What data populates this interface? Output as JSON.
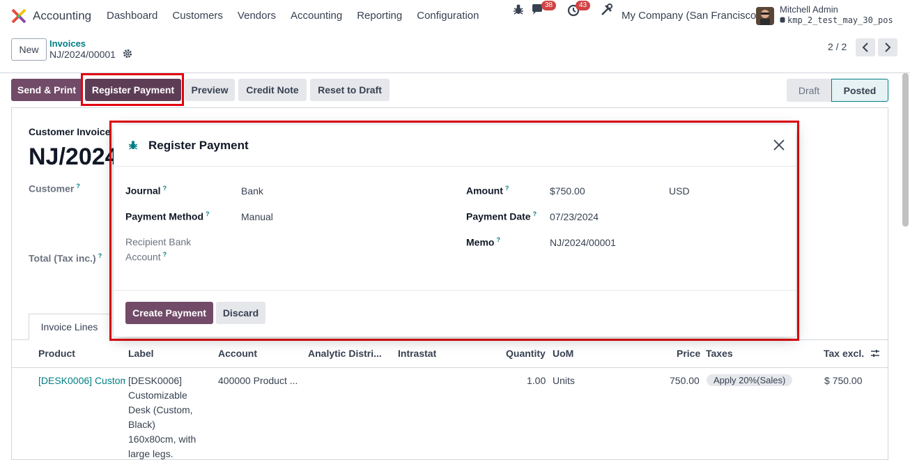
{
  "navbar": {
    "app_name": "Accounting",
    "menu": [
      "Dashboard",
      "Customers",
      "Vendors",
      "Accounting",
      "Reporting",
      "Configuration"
    ],
    "chat_badge": "38",
    "activity_badge": "43",
    "company": "My Company (San Francisco)",
    "user_name": "Mitchell Admin",
    "db_name": "kmp_2_test_may_30_pos"
  },
  "control": {
    "new_label": "New",
    "breadcrumb_parent": "Invoices",
    "breadcrumb_current": "NJ/2024/00001",
    "pager": "2 / 2"
  },
  "actions": {
    "send_print": "Send & Print",
    "register_payment": "Register Payment",
    "preview": "Preview",
    "credit_note": "Credit Note",
    "reset_draft": "Reset to Draft",
    "status_draft": "Draft",
    "status_posted": "Posted"
  },
  "sheet": {
    "type": "Customer Invoice",
    "name_partial": "NJ/2024",
    "customer_label": "Customer",
    "total_label": "Total (Tax inc.)",
    "tab_lines": "Invoice Lines",
    "columns": [
      "Product",
      "Label",
      "Account",
      "Analytic Distri...",
      "Intrastat",
      "Quantity",
      "UoM",
      "Price",
      "Taxes",
      "Tax excl."
    ],
    "row": {
      "product": "[DESK0006] Custom",
      "label_lines": [
        "[DESK0006]",
        "Customizable",
        "Desk (Custom,",
        "Black)",
        "160x80cm, with",
        "large legs."
      ],
      "account": "400000 Product ...",
      "quantity": "1.00",
      "uom": "Units",
      "price": "750.00",
      "tax": "Apply 20%(Sales)",
      "tax_excl": "$ 750.00"
    }
  },
  "modal": {
    "title": "Register Payment",
    "journal_label": "Journal",
    "journal_value": "Bank",
    "method_label": "Payment Method",
    "method_value": "Manual",
    "recipient_label_1": "Recipient Bank",
    "recipient_label_2": "Account",
    "amount_label": "Amount",
    "amount_value": "$750.00",
    "currency": "USD",
    "date_label": "Payment Date",
    "date_value": "07/23/2024",
    "memo_label": "Memo",
    "memo_value": "NJ/2024/00001",
    "create_label": "Create Payment",
    "discard_label": "Discard",
    "help_mark": "?"
  },
  "colors": {
    "primary": "#714b67",
    "link": "#017e84",
    "highlight": "#e3000f"
  }
}
